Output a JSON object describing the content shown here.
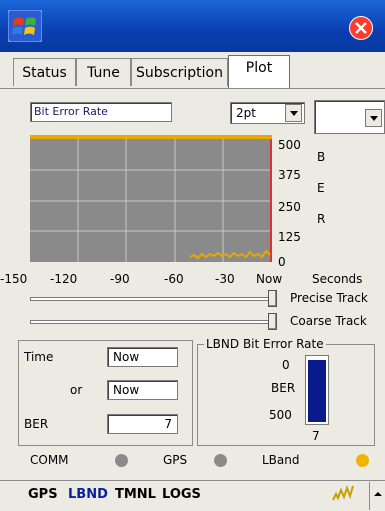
{
  "tabs": [
    "Status",
    "Tune",
    "Subscription",
    "Plot"
  ],
  "plot": {
    "title_value": "Bit Error Rate",
    "format_selected": "2pt",
    "y_ticks": [
      "500",
      "375",
      "250",
      "125",
      "0"
    ],
    "side_letters": [
      "B",
      "E",
      "R"
    ],
    "x_ticks": [
      "-150",
      "-120",
      "-90",
      "-60",
      "-30",
      "Now"
    ],
    "x_unit": "Seconds"
  },
  "sliders": [
    {
      "label": "Precise Track",
      "value": 1.0
    },
    {
      "label": "Coarse Track",
      "value": 1.0
    }
  ],
  "time_group": {
    "time_label": "Time",
    "or_label": "or",
    "time_value": "Now",
    "or_value": "Now",
    "ber_label": "BER",
    "ber_value": "7"
  },
  "lbnd_group": {
    "legend": "LBND Bit Error Rate",
    "top": "0",
    "mid": "BER",
    "bottom": "500",
    "value": "7"
  },
  "status": {
    "comm": "COMM",
    "gps": "GPS",
    "lband": "LBand",
    "colors": {
      "inactive": "#8a8a8a",
      "active": "#f0b400"
    }
  },
  "bottombar": {
    "items": [
      "GPS",
      "LBND",
      "TMNL",
      "LOGS"
    ],
    "colors": {
      "normal": "#000000",
      "selected": "#0a1ea0"
    }
  },
  "colors": {
    "titlebar": "#0a3fb0",
    "plot_bg": "#8a8a8a",
    "trace": "#e8a800",
    "bar": "#0a1a8c"
  }
}
